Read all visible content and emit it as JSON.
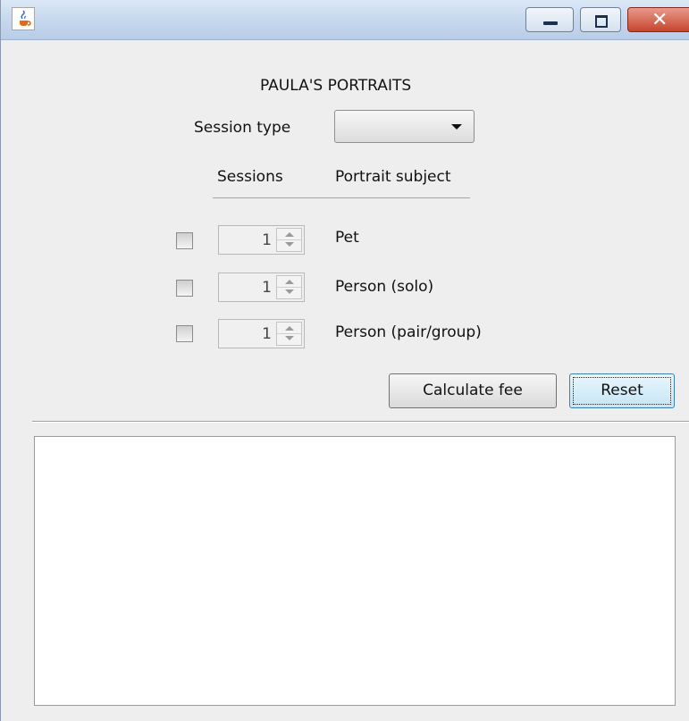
{
  "window": {
    "title": "",
    "app_icon": "java-cup-icon",
    "controls": {
      "minimize": "minimize-icon",
      "maximize": "maximize-icon",
      "close": "close-icon",
      "close_glyph": "✕"
    }
  },
  "form": {
    "title": "PAULA'S PORTRAITS",
    "session_type_label": "Session type",
    "session_type_value": "",
    "headers": {
      "sessions": "Sessions",
      "subject": "Portrait subject"
    },
    "rows": [
      {
        "checked": false,
        "sessions": "1",
        "subject": "Pet"
      },
      {
        "checked": false,
        "sessions": "1",
        "subject": "Person (solo)"
      },
      {
        "checked": false,
        "sessions": "1",
        "subject": "Person (pair/group)"
      }
    ],
    "calculate_label": "Calculate fee",
    "reset_label": "Reset"
  },
  "output": {
    "text": ""
  },
  "colors": {
    "window_bg": "#eeeeee",
    "titlebar": "#c5d7ee",
    "close_button": "#c7452f",
    "focus_button": "#c4e5f6"
  }
}
